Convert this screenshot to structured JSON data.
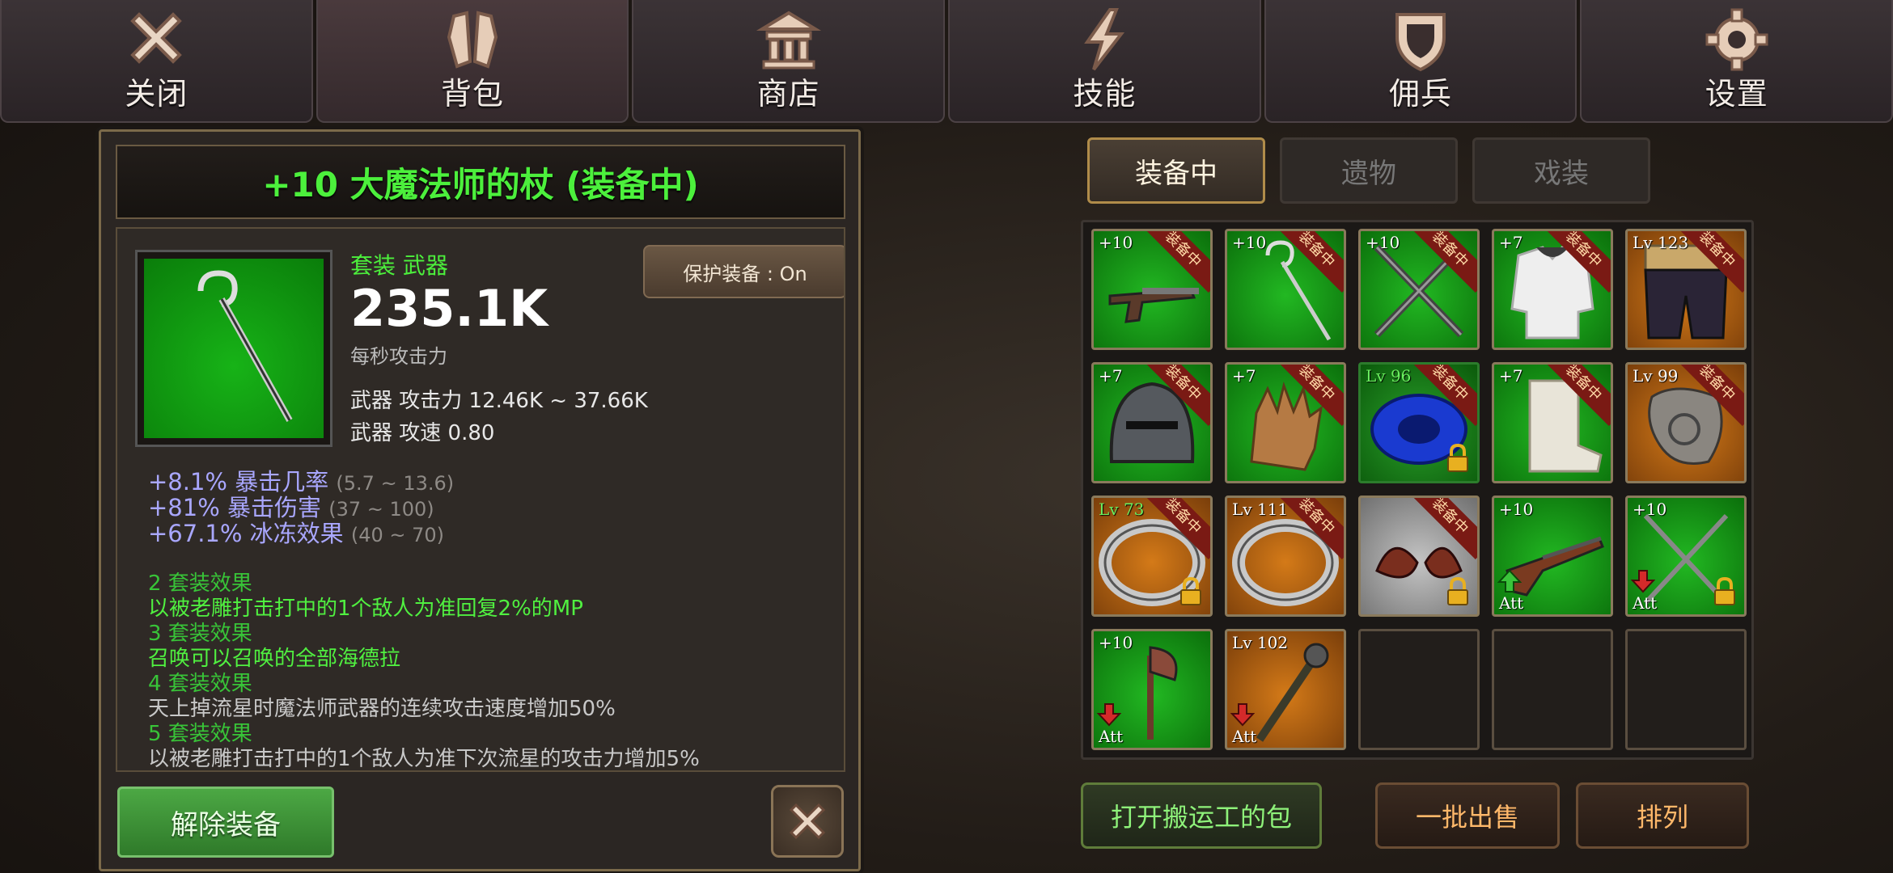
{
  "nav": {
    "tabs": [
      {
        "label": "关闭",
        "icon": "close-icon"
      },
      {
        "label": "背包",
        "icon": "backpack-icon"
      },
      {
        "label": "商店",
        "icon": "shop-icon"
      },
      {
        "label": "技能",
        "icon": "skill-lightning-icon"
      },
      {
        "label": "佣兵",
        "icon": "shield-mercenary-icon"
      },
      {
        "label": "设置",
        "icon": "gear-icon"
      }
    ],
    "active_index": 1
  },
  "detail": {
    "title": "+10 大魔法师的杖 (装备中)",
    "category": "套装 武器",
    "dps": "235.1K",
    "dps_label": "每秒攻击力",
    "protect_label": "保护装备 : On",
    "weapon_attack": "武器 攻击力 12.46K ~ 37.66K",
    "weapon_speed": "武器 攻速 0.80",
    "attributes": [
      {
        "text": "+8.1% 暴击几率",
        "range": "(5.7 ~ 13.6)"
      },
      {
        "text": "+81% 暴击伤害",
        "range": "(37 ~ 100)"
      },
      {
        "text": "+67.1% 冰冻效果",
        "range": "(40 ~ 70)"
      }
    ],
    "set_effects": [
      {
        "header": "2 套装效果",
        "desc": "以被老雕打击打中的1个敌人为准回复2%的MP",
        "active": true
      },
      {
        "header": "3 套装效果",
        "desc": "召唤可以召唤的全部海德拉",
        "active": true
      },
      {
        "header": "4 套装效果",
        "desc": "天上掉流星时魔法师武器的连续攻击速度增加50%",
        "active": false
      },
      {
        "header": "5 套装效果",
        "desc": "以被老雕打击打中的1个敌人为准下次流星的攻击力增加5%",
        "active": false
      }
    ],
    "unequip_label": "解除装备"
  },
  "inventory": {
    "subtabs": [
      "装备中",
      "遗物",
      "戏装"
    ],
    "active_subtab": 0,
    "equipped_tag": "装备中",
    "slots": [
      {
        "lv": "+10",
        "bg": "g",
        "art": "pistol",
        "equipped": true
      },
      {
        "lv": "+10",
        "bg": "g",
        "art": "staff",
        "equipped": true
      },
      {
        "lv": "+10",
        "bg": "g",
        "art": "swords",
        "equipped": true
      },
      {
        "lv": "+7",
        "bg": "g",
        "art": "armor",
        "equipped": true
      },
      {
        "lv": "Lv 123",
        "bg": "o",
        "art": "pants",
        "equipped": true
      },
      {
        "lv": "+7",
        "bg": "g",
        "art": "helmet",
        "equipped": true
      },
      {
        "lv": "+7",
        "bg": "g",
        "art": "glove",
        "equipped": true
      },
      {
        "lv": "Lv 96",
        "bg": "b",
        "art": "belt",
        "equipped": true,
        "locked": true,
        "lv_green": true
      },
      {
        "lv": "+7",
        "bg": "g",
        "art": "boot",
        "equipped": true
      },
      {
        "lv": "Lv 99",
        "bg": "o",
        "art": "horn",
        "equipped": true
      },
      {
        "lv": "Lv 73",
        "bg": "o",
        "art": "ring",
        "equipped": true,
        "locked": true,
        "lv_green": true
      },
      {
        "lv": "Lv 111",
        "bg": "o",
        "art": "ring",
        "equipped": true
      },
      {
        "lv": "",
        "bg": "gr",
        "art": "wings",
        "equipped": true,
        "locked": true
      },
      {
        "lv": "+10",
        "bg": "g",
        "art": "rifle",
        "att": "Att",
        "arrow": "up"
      },
      {
        "lv": "+10",
        "bg": "g",
        "art": "spears",
        "att": "Att",
        "arrow": "down",
        "locked": true
      },
      {
        "lv": "+10",
        "bg": "g",
        "art": "axe",
        "att": "Att",
        "arrow": "down"
      },
      {
        "lv": "Lv 102",
        "bg": "o",
        "art": "mace",
        "att": "Att",
        "arrow": "down"
      },
      {
        "lv": "",
        "bg": "empty"
      },
      {
        "lv": "",
        "bg": "empty"
      },
      {
        "lv": "",
        "bg": "empty"
      }
    ],
    "buttons": {
      "porter_bag": "打开搬运工的包",
      "bulk_sell": "一批出售",
      "sort": "排列"
    }
  }
}
